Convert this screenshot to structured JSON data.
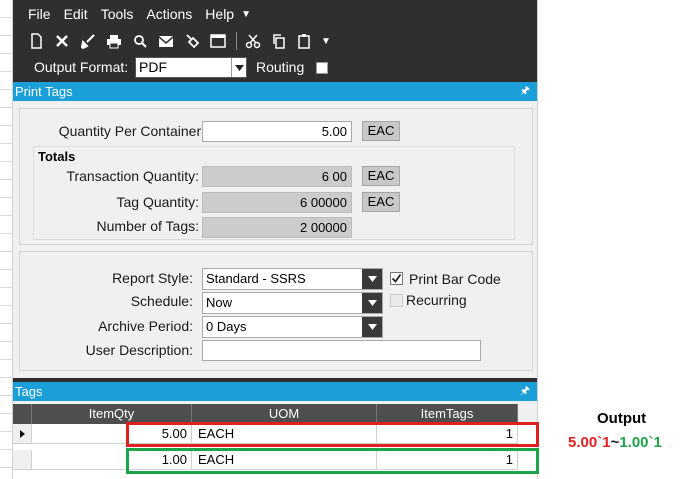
{
  "menu": {
    "items": [
      "File",
      "Edit",
      "Tools",
      "Actions",
      "Help"
    ]
  },
  "toolbar": {
    "icons": [
      "new-icon",
      "delete-icon",
      "clear-icon",
      "print-icon",
      "print-preview-icon",
      "send-icon",
      "attach-icon",
      "window-icon",
      "cut-icon",
      "copy-icon",
      "paste-icon"
    ]
  },
  "format_bar": {
    "output_format_label": "Output Format:",
    "output_format_value": "PDF",
    "routing_label": "Routing"
  },
  "print_tags": {
    "header": "Print Tags",
    "quantity_per_container_label": "Quantity Per Container:",
    "quantity_per_container_value": "5.00",
    "quantity_per_container_uom": "EAC",
    "totals_title": "Totals",
    "transaction_quantity_label": "Transaction Quantity:",
    "transaction_quantity_value": "6 00",
    "transaction_quantity_uom": "EAC",
    "tag_quantity_label": "Tag Quantity:",
    "tag_quantity_value": "6 00000",
    "tag_quantity_uom": "EAC",
    "number_of_tags_label": "Number of Tags:",
    "number_of_tags_value": "2 00000",
    "report_style_label": "Report Style:",
    "report_style_value": "Standard - SSRS",
    "print_bar_code_label": "Print Bar Code",
    "print_bar_code_checked": true,
    "schedule_label": "Schedule:",
    "schedule_value": "Now",
    "recurring_label": "Recurring",
    "archive_period_label": "Archive Period:",
    "archive_period_value": "0 Days",
    "user_description_label": "User Description:",
    "user_description_value": ""
  },
  "tags": {
    "header": "Tags",
    "columns": [
      "ItemQty",
      "UOM",
      "ItemTags"
    ],
    "rows": [
      {
        "qty": "5.00",
        "uom": "EACH",
        "tags": "1"
      },
      {
        "qty": "1.00",
        "uom": "EACH",
        "tags": "1"
      }
    ]
  },
  "annotation": {
    "title": "Output",
    "value_red": "5.00`1",
    "separator": "~",
    "value_green": "1.00`1"
  },
  "colors": {
    "section_header": "#1a9fd8",
    "dark_bar": "#2f2f2f",
    "highlight_red": "#e02020",
    "highlight_green": "#1ea34a"
  }
}
